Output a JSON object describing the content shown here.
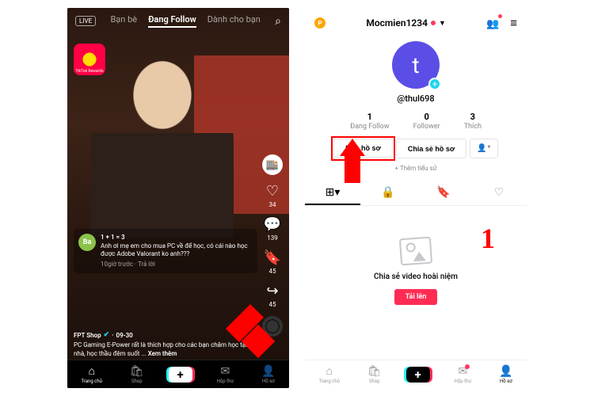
{
  "left": {
    "topTabs": {
      "friends": "Bạn bè",
      "following": "Đang Follow",
      "forYou": "Dành cho bạn"
    },
    "rewards": "TikTok Rewards",
    "actions": {
      "likes": "34",
      "comments": "139",
      "bookmarks": "45",
      "shares": "45"
    },
    "comment": {
      "avatarText": "Ba",
      "user": "1 + 1 = 3",
      "text": "Anh ơi mẹ em cho mua PC về để học, có cái nào học được Adobe Valorant ko anh???",
      "time": "10giờ trước",
      "reply": "Trả lời"
    },
    "caption": {
      "user": "FPT Shop",
      "date": "09-30",
      "text": "PC Gaming E-Power rất là thích hợp cho các bạn chăm học tại nhà, học thầu đêm suốt ...",
      "more": "Xem thêm"
    },
    "nav": {
      "home": "Trang chủ",
      "shop": "Shop",
      "inbox": "Hộp thư",
      "profile": "Hồ sơ"
    }
  },
  "right": {
    "headerName": "Mocmien1234",
    "avatarLetter": "t",
    "username": "@thul698",
    "stats": {
      "following": {
        "num": "1",
        "label": "Đang Follow"
      },
      "followers": {
        "num": "0",
        "label": "Follower"
      },
      "likes": {
        "num": "3",
        "label": "Thích"
      }
    },
    "buttons": {
      "edit": "Sửa hồ sơ",
      "share": "Chia sẻ hồ sơ"
    },
    "addBio": "+ Thêm tiểu sử",
    "empty": {
      "title": "Chia sẻ video hoài niệm",
      "upload": "Tải lên"
    },
    "nav": {
      "home": "Trang chủ",
      "shop": "Shop",
      "inbox": "Hộp thư",
      "profile": "Hồ sơ"
    },
    "stepNum": "1"
  }
}
